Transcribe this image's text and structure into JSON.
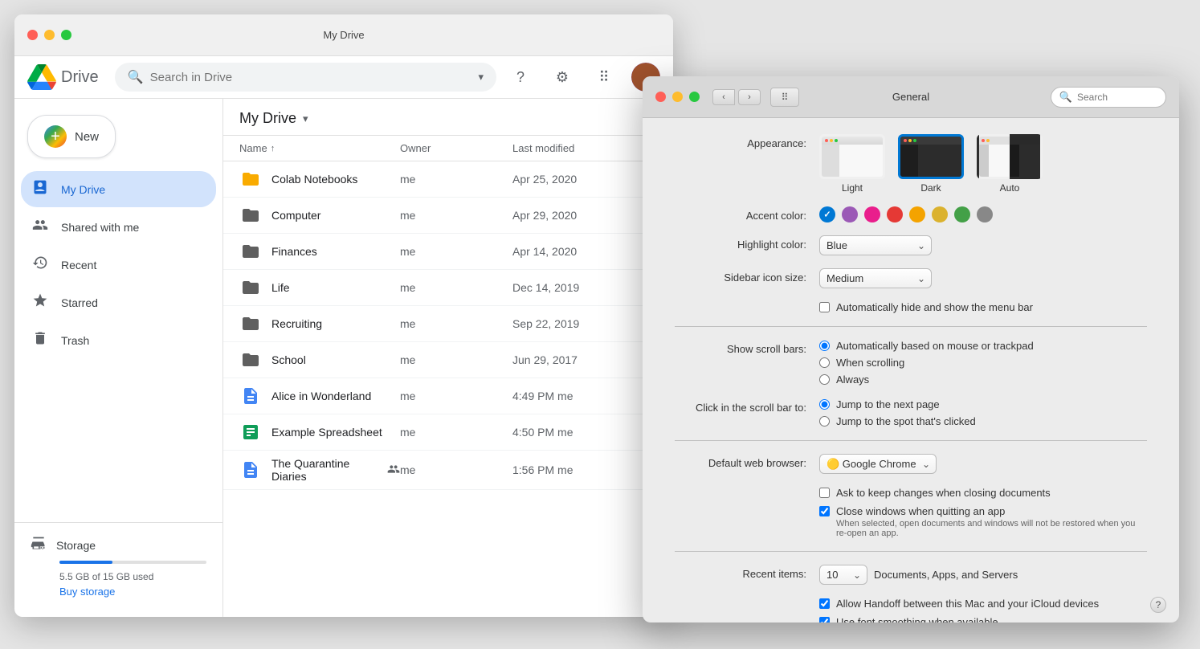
{
  "drive_window": {
    "title": "My Drive",
    "logo_text": "Drive",
    "search_placeholder": "Search in Drive",
    "header_title": "My Drive",
    "new_button_label": "New",
    "sidebar": {
      "items": [
        {
          "id": "my-drive",
          "label": "My Drive",
          "active": true
        },
        {
          "id": "shared",
          "label": "Shared with me"
        },
        {
          "id": "recent",
          "label": "Recent"
        },
        {
          "id": "starred",
          "label": "Starred"
        },
        {
          "id": "trash",
          "label": "Trash"
        }
      ],
      "storage_label": "Storage",
      "storage_used": "5.5 GB of 15 GB used",
      "buy_storage_label": "Buy storage",
      "storage_percent": 36
    },
    "file_list": {
      "columns": {
        "name": "Name",
        "owner": "Owner",
        "modified": "Last modified"
      },
      "files": [
        {
          "name": "Colab Notebooks",
          "type": "folder-yellow",
          "owner": "me",
          "modified": "Apr 25, 2020",
          "shared": false
        },
        {
          "name": "Computer",
          "type": "folder-dark",
          "owner": "me",
          "modified": "Apr 29, 2020",
          "shared": false
        },
        {
          "name": "Finances",
          "type": "folder-dark",
          "owner": "me",
          "modified": "Apr 14, 2020",
          "shared": false
        },
        {
          "name": "Life",
          "type": "folder-dark",
          "owner": "me",
          "modified": "Dec 14, 2019",
          "shared": false
        },
        {
          "name": "Recruiting",
          "type": "folder-dark",
          "owner": "me",
          "modified": "Sep 22, 2019",
          "shared": false
        },
        {
          "name": "School",
          "type": "folder-dark",
          "owner": "me",
          "modified": "Jun 29, 2017",
          "shared": false
        },
        {
          "name": "Alice in Wonderland",
          "type": "doc",
          "owner": "me",
          "modified": "4:49 PM me",
          "shared": false
        },
        {
          "name": "Example Spreadsheet",
          "type": "sheet",
          "owner": "me",
          "modified": "4:50 PM me",
          "shared": false
        },
        {
          "name": "The Quarantine Diaries",
          "type": "doc",
          "owner": "me",
          "modified": "1:56 PM me",
          "shared": true
        }
      ]
    }
  },
  "syspref_window": {
    "title": "General",
    "search_placeholder": "Search",
    "sections": {
      "appearance": {
        "label": "Appearance:",
        "options": [
          {
            "id": "light",
            "label": "Light"
          },
          {
            "id": "dark",
            "label": "Dark"
          },
          {
            "id": "auto",
            "label": "Auto"
          }
        ],
        "selected": "dark"
      },
      "accent_color": {
        "label": "Accent color:",
        "colors": [
          {
            "id": "blue",
            "hex": "#0078d4",
            "selected": true
          },
          {
            "id": "purple",
            "hex": "#9b59b6"
          },
          {
            "id": "pink",
            "hex": "#e91e8c"
          },
          {
            "id": "red",
            "hex": "#e53935"
          },
          {
            "id": "orange",
            "hex": "#f4a300"
          },
          {
            "id": "yellow",
            "hex": "#dbb22e"
          },
          {
            "id": "green",
            "hex": "#43a047"
          },
          {
            "id": "graphite",
            "hex": "#888888"
          }
        ]
      },
      "highlight_color": {
        "label": "Highlight color:",
        "value": "Blue"
      },
      "sidebar_icon_size": {
        "label": "Sidebar icon size:",
        "value": "Medium"
      },
      "menu_bar": {
        "label": "Automatically hide and show the menu bar",
        "checked": false
      },
      "show_scroll_bars": {
        "label": "Show scroll bars:",
        "options": [
          {
            "id": "auto",
            "label": "Automatically based on mouse or trackpad",
            "selected": true
          },
          {
            "id": "scrolling",
            "label": "When scrolling"
          },
          {
            "id": "always",
            "label": "Always"
          }
        ]
      },
      "click_scroll_bar": {
        "label": "Click in the scroll bar to:",
        "options": [
          {
            "id": "next_page",
            "label": "Jump to the next page",
            "selected": true
          },
          {
            "id": "spot",
            "label": "Jump to the spot that's clicked"
          }
        ]
      },
      "default_browser": {
        "label": "Default web browser:",
        "value": "Google Chrome"
      },
      "close_on_quit": {
        "label": "Ask to keep changes when closing documents",
        "checked": false
      },
      "close_windows": {
        "label": "Close windows when quitting an app",
        "checked": true,
        "sublabel": "When selected, open documents and windows will not be restored when you re-open an app."
      },
      "recent_items": {
        "label": "Recent items:",
        "count": "10",
        "suffix": "Documents, Apps, and Servers"
      },
      "handoff": {
        "label": "Allow Handoff between this Mac and your iCloud devices",
        "checked": true
      },
      "font_smoothing": {
        "label": "Use font smoothing when available",
        "checked": true
      }
    }
  }
}
